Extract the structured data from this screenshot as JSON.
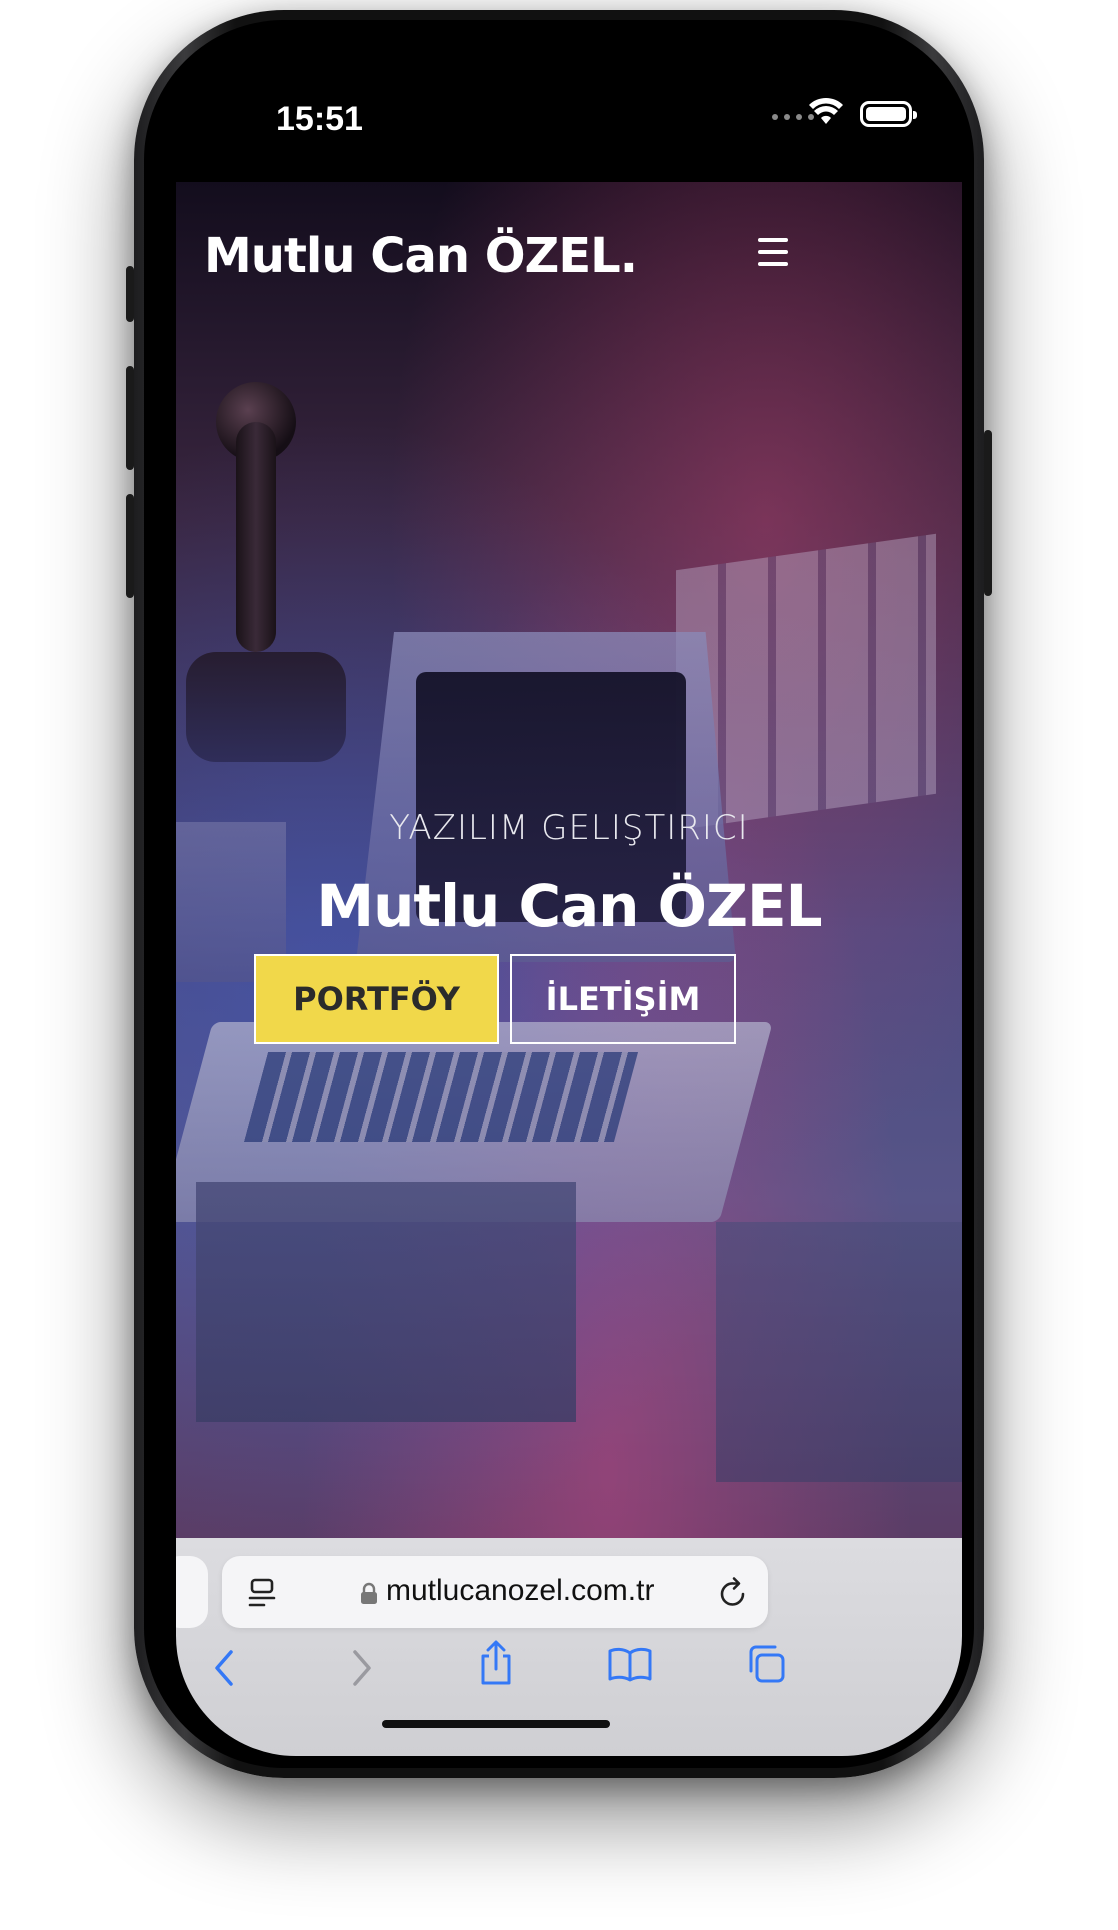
{
  "status_bar": {
    "time": "15:51"
  },
  "site": {
    "logo": "Mutlu Can ÖZEL.",
    "hero": {
      "subtitle": "YAZILIM GELIŞTIRICI",
      "title": "Mutlu Can ÖZEL",
      "primary_button": "PORTFÖY",
      "secondary_button": "İLETİŞİM"
    }
  },
  "browser": {
    "url": "mutlucanozel.com.tr",
    "nav_icons": [
      "back-icon",
      "forward-icon",
      "share-icon",
      "bookmarks-icon",
      "tabs-icon"
    ]
  },
  "colors": {
    "accent": "#f1d84a",
    "browser_blue": "#3478f6"
  }
}
